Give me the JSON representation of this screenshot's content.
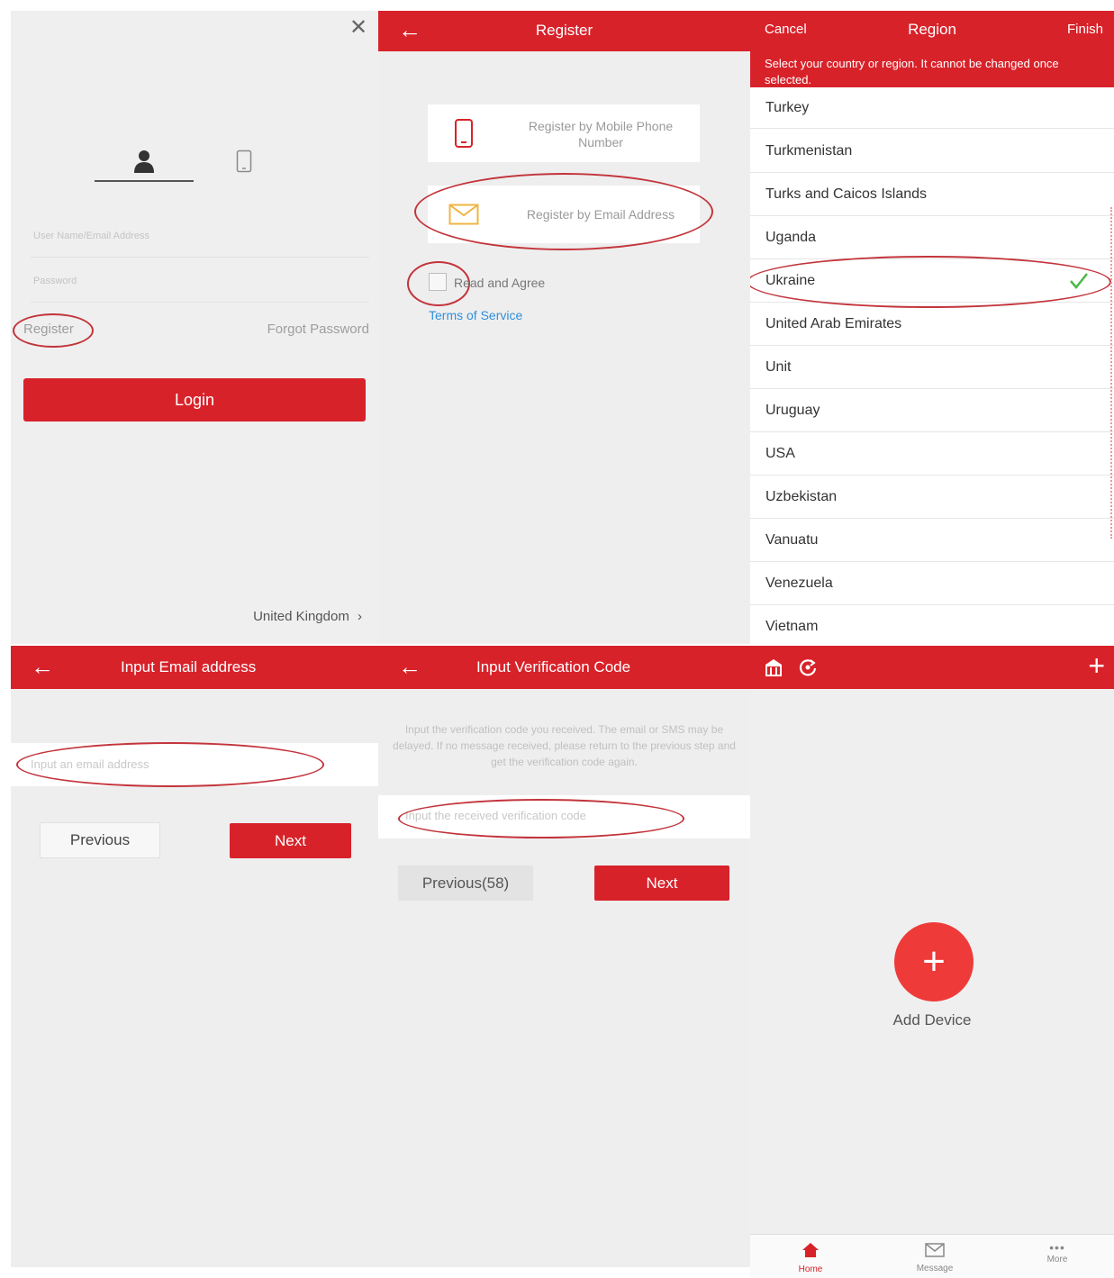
{
  "colors": {
    "accent": "#d8222a",
    "link": "#2f8fdc",
    "check": "#4cb848",
    "background": "#eeeeee"
  },
  "login": {
    "close_icon": "close-icon",
    "username_placeholder": "User Name/Email Address",
    "password_placeholder": "Password",
    "register_label": "Register",
    "forgot_label": "Forgot Password",
    "login_label": "Login",
    "region_label": "United Kingdom"
  },
  "register": {
    "title": "Register",
    "by_phone_label": "Register by Mobile Phone Number",
    "by_email_label": "Register by Email Address",
    "agree_label": "Read and Agree",
    "terms_label": "Terms of Service"
  },
  "region": {
    "cancel_label": "Cancel",
    "title": "Region",
    "finish_label": "Finish",
    "notice": "Select your country or region. It cannot be changed once selected.",
    "countries": [
      "Turkey",
      "Turkmenistan",
      "Turks and Caicos Islands",
      "Uganda",
      "Ukraine",
      "United Arab Emirates",
      "Unit",
      "Uruguay",
      "USA",
      "Uzbekistan",
      "Vanuatu",
      "Venezuela",
      "Vietnam"
    ],
    "selected": "Ukraine"
  },
  "email_step": {
    "title": "Input Email address",
    "placeholder": "Input an email address",
    "previous_label": "Previous",
    "next_label": "Next"
  },
  "verify_step": {
    "title": "Input Verification Code",
    "hint": "Input the verification code you received. The email or SMS may be delayed. If no message received, please return to the previous step and get the verification code again.",
    "placeholder": "Input the received verification code",
    "previous_label": "Previous(58)",
    "next_label": "Next"
  },
  "home": {
    "add_device_label": "Add Device",
    "tabs": [
      {
        "label": "Home"
      },
      {
        "label": "Message"
      },
      {
        "label": "More"
      }
    ]
  }
}
